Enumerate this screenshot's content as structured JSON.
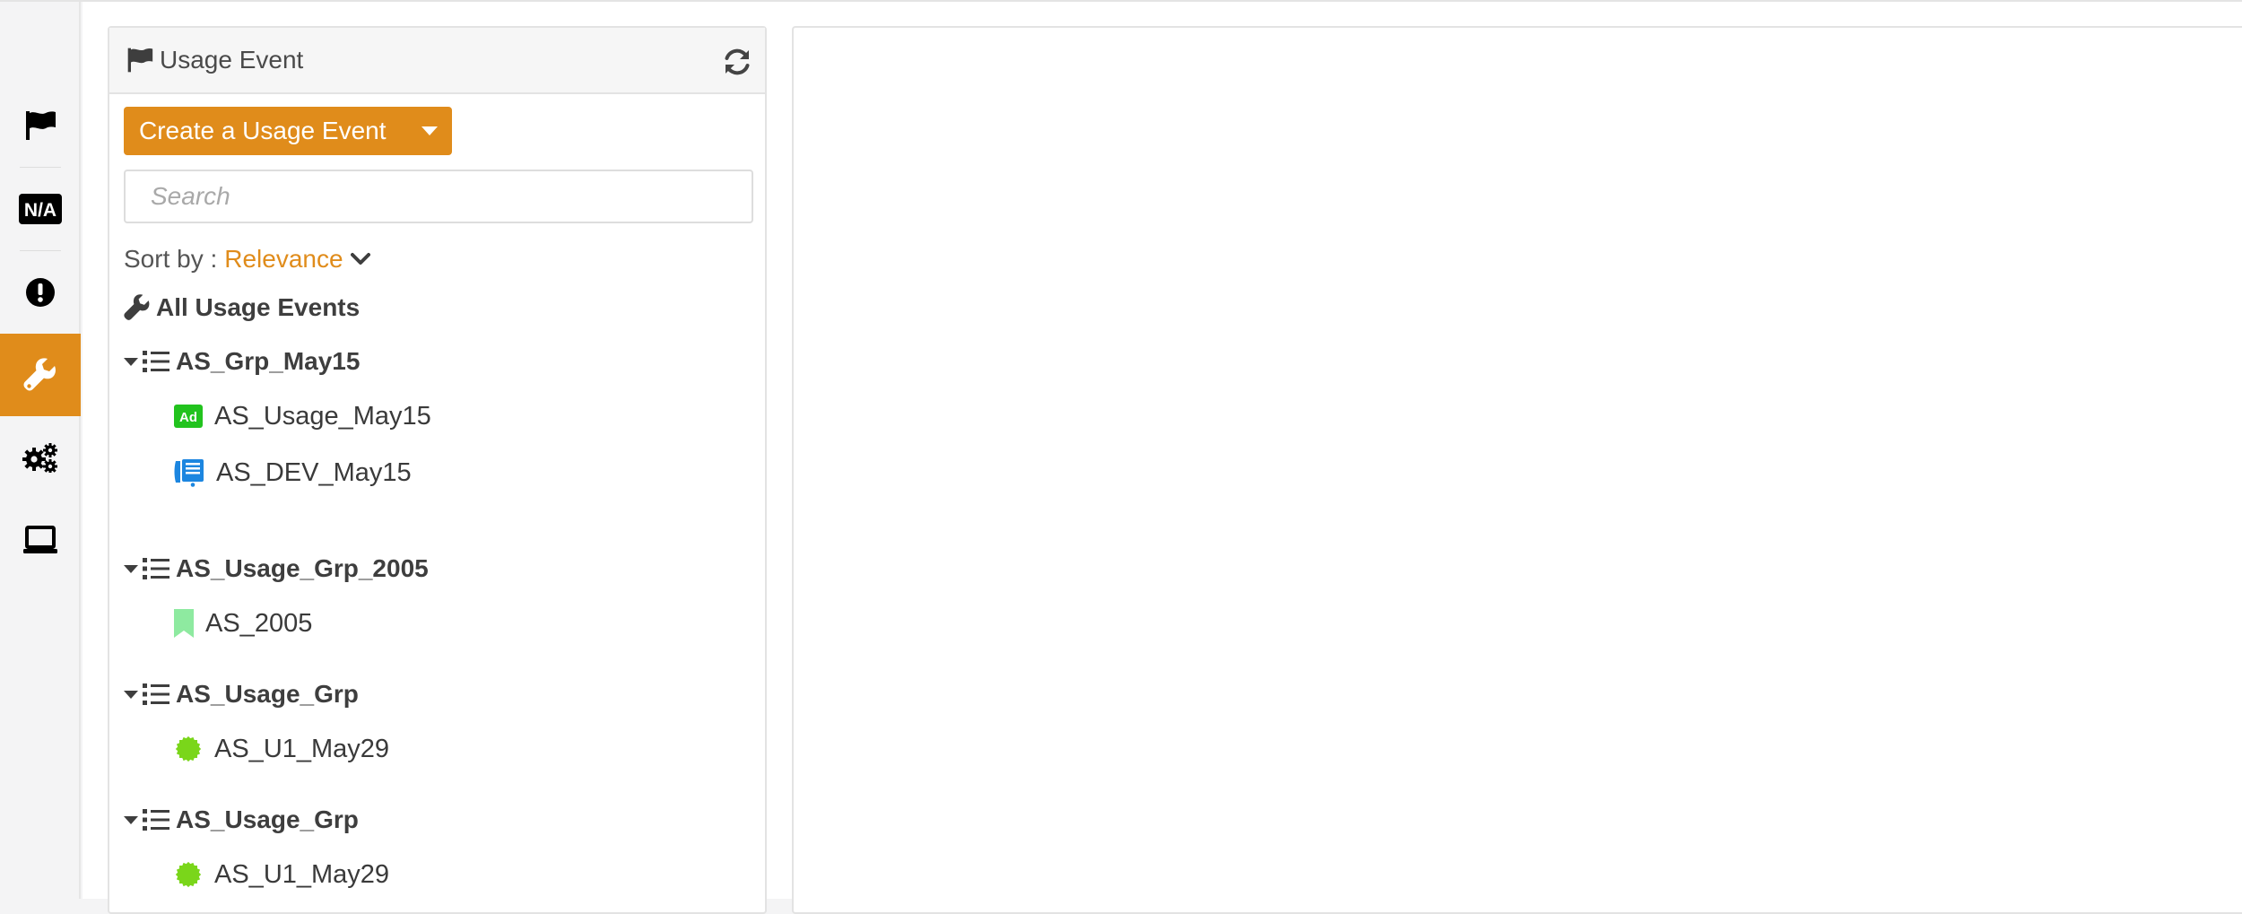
{
  "rail": {
    "items": [
      {
        "icon": "flag-icon",
        "active": false
      },
      {
        "icon": "na-icon",
        "label": "N/A",
        "active": false
      },
      {
        "icon": "alert-icon",
        "active": false
      },
      {
        "icon": "wrench-icon",
        "active": true
      },
      {
        "icon": "gears-icon",
        "active": false
      },
      {
        "icon": "laptop-icon",
        "active": false
      }
    ],
    "accent": "#e08c1b"
  },
  "panel": {
    "title": "Usage Event",
    "create_label": "Create a Usage Event",
    "search_placeholder": "Search",
    "sort_label": "Sort by :",
    "sort_value": "Relevance",
    "all_label": "All Usage Events",
    "groups": [
      {
        "label": "AS_Grp_May15",
        "items": [
          {
            "label": "AS_Usage_May15",
            "icon": "ad-icon",
            "color": "#22c31e"
          },
          {
            "label": "AS_DEV_May15",
            "icon": "device-icon",
            "color": "#1c86e0"
          }
        ]
      },
      {
        "label": "AS_Usage_Grp_2005",
        "items": [
          {
            "label": "AS_2005",
            "icon": "bookmark-icon",
            "color": "#8eeaa0"
          }
        ]
      },
      {
        "label": "AS_Usage_Grp",
        "items": [
          {
            "label": "AS_U1_May29",
            "icon": "badge-icon",
            "color": "#7ad61a"
          }
        ]
      },
      {
        "label": "AS_Usage_Grp",
        "items": [
          {
            "label": "AS_U1_May29",
            "icon": "badge-icon",
            "color": "#7ad61a"
          }
        ]
      }
    ]
  }
}
